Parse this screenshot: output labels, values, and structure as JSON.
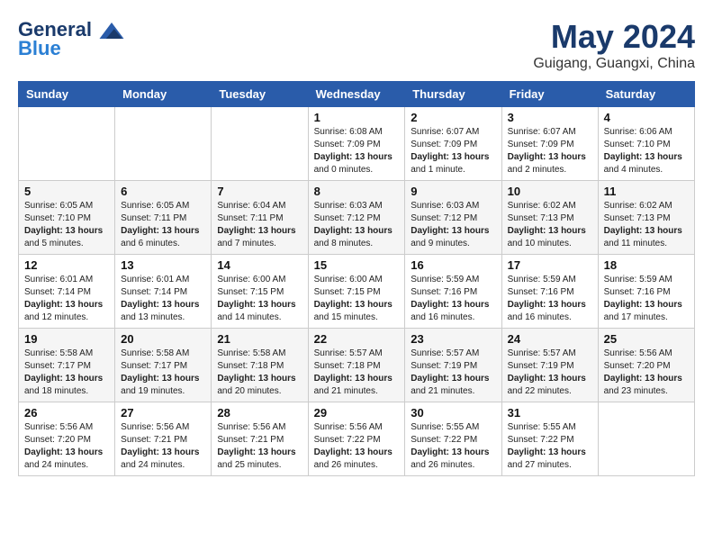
{
  "logo": {
    "line1": "General",
    "line2": "Blue"
  },
  "title": "May 2024",
  "location": "Guigang, Guangxi, China",
  "weekdays": [
    "Sunday",
    "Monday",
    "Tuesday",
    "Wednesday",
    "Thursday",
    "Friday",
    "Saturday"
  ],
  "weeks": [
    [
      {
        "day": "",
        "info": ""
      },
      {
        "day": "",
        "info": ""
      },
      {
        "day": "",
        "info": ""
      },
      {
        "day": "1",
        "info": "Sunrise: 6:08 AM\nSunset: 7:09 PM\nDaylight: 13 hours\nand 0 minutes."
      },
      {
        "day": "2",
        "info": "Sunrise: 6:07 AM\nSunset: 7:09 PM\nDaylight: 13 hours\nand 1 minute."
      },
      {
        "day": "3",
        "info": "Sunrise: 6:07 AM\nSunset: 7:09 PM\nDaylight: 13 hours\nand 2 minutes."
      },
      {
        "day": "4",
        "info": "Sunrise: 6:06 AM\nSunset: 7:10 PM\nDaylight: 13 hours\nand 4 minutes."
      }
    ],
    [
      {
        "day": "5",
        "info": "Sunrise: 6:05 AM\nSunset: 7:10 PM\nDaylight: 13 hours\nand 5 minutes."
      },
      {
        "day": "6",
        "info": "Sunrise: 6:05 AM\nSunset: 7:11 PM\nDaylight: 13 hours\nand 6 minutes."
      },
      {
        "day": "7",
        "info": "Sunrise: 6:04 AM\nSunset: 7:11 PM\nDaylight: 13 hours\nand 7 minutes."
      },
      {
        "day": "8",
        "info": "Sunrise: 6:03 AM\nSunset: 7:12 PM\nDaylight: 13 hours\nand 8 minutes."
      },
      {
        "day": "9",
        "info": "Sunrise: 6:03 AM\nSunset: 7:12 PM\nDaylight: 13 hours\nand 9 minutes."
      },
      {
        "day": "10",
        "info": "Sunrise: 6:02 AM\nSunset: 7:13 PM\nDaylight: 13 hours\nand 10 minutes."
      },
      {
        "day": "11",
        "info": "Sunrise: 6:02 AM\nSunset: 7:13 PM\nDaylight: 13 hours\nand 11 minutes."
      }
    ],
    [
      {
        "day": "12",
        "info": "Sunrise: 6:01 AM\nSunset: 7:14 PM\nDaylight: 13 hours\nand 12 minutes."
      },
      {
        "day": "13",
        "info": "Sunrise: 6:01 AM\nSunset: 7:14 PM\nDaylight: 13 hours\nand 13 minutes."
      },
      {
        "day": "14",
        "info": "Sunrise: 6:00 AM\nSunset: 7:15 PM\nDaylight: 13 hours\nand 14 minutes."
      },
      {
        "day": "15",
        "info": "Sunrise: 6:00 AM\nSunset: 7:15 PM\nDaylight: 13 hours\nand 15 minutes."
      },
      {
        "day": "16",
        "info": "Sunrise: 5:59 AM\nSunset: 7:16 PM\nDaylight: 13 hours\nand 16 minutes."
      },
      {
        "day": "17",
        "info": "Sunrise: 5:59 AM\nSunset: 7:16 PM\nDaylight: 13 hours\nand 16 minutes."
      },
      {
        "day": "18",
        "info": "Sunrise: 5:59 AM\nSunset: 7:16 PM\nDaylight: 13 hours\nand 17 minutes."
      }
    ],
    [
      {
        "day": "19",
        "info": "Sunrise: 5:58 AM\nSunset: 7:17 PM\nDaylight: 13 hours\nand 18 minutes."
      },
      {
        "day": "20",
        "info": "Sunrise: 5:58 AM\nSunset: 7:17 PM\nDaylight: 13 hours\nand 19 minutes."
      },
      {
        "day": "21",
        "info": "Sunrise: 5:58 AM\nSunset: 7:18 PM\nDaylight: 13 hours\nand 20 minutes."
      },
      {
        "day": "22",
        "info": "Sunrise: 5:57 AM\nSunset: 7:18 PM\nDaylight: 13 hours\nand 21 minutes."
      },
      {
        "day": "23",
        "info": "Sunrise: 5:57 AM\nSunset: 7:19 PM\nDaylight: 13 hours\nand 21 minutes."
      },
      {
        "day": "24",
        "info": "Sunrise: 5:57 AM\nSunset: 7:19 PM\nDaylight: 13 hours\nand 22 minutes."
      },
      {
        "day": "25",
        "info": "Sunrise: 5:56 AM\nSunset: 7:20 PM\nDaylight: 13 hours\nand 23 minutes."
      }
    ],
    [
      {
        "day": "26",
        "info": "Sunrise: 5:56 AM\nSunset: 7:20 PM\nDaylight: 13 hours\nand 24 minutes."
      },
      {
        "day": "27",
        "info": "Sunrise: 5:56 AM\nSunset: 7:21 PM\nDaylight: 13 hours\nand 24 minutes."
      },
      {
        "day": "28",
        "info": "Sunrise: 5:56 AM\nSunset: 7:21 PM\nDaylight: 13 hours\nand 25 minutes."
      },
      {
        "day": "29",
        "info": "Sunrise: 5:56 AM\nSunset: 7:22 PM\nDaylight: 13 hours\nand 26 minutes."
      },
      {
        "day": "30",
        "info": "Sunrise: 5:55 AM\nSunset: 7:22 PM\nDaylight: 13 hours\nand 26 minutes."
      },
      {
        "day": "31",
        "info": "Sunrise: 5:55 AM\nSunset: 7:22 PM\nDaylight: 13 hours\nand 27 minutes."
      },
      {
        "day": "",
        "info": ""
      }
    ]
  ]
}
